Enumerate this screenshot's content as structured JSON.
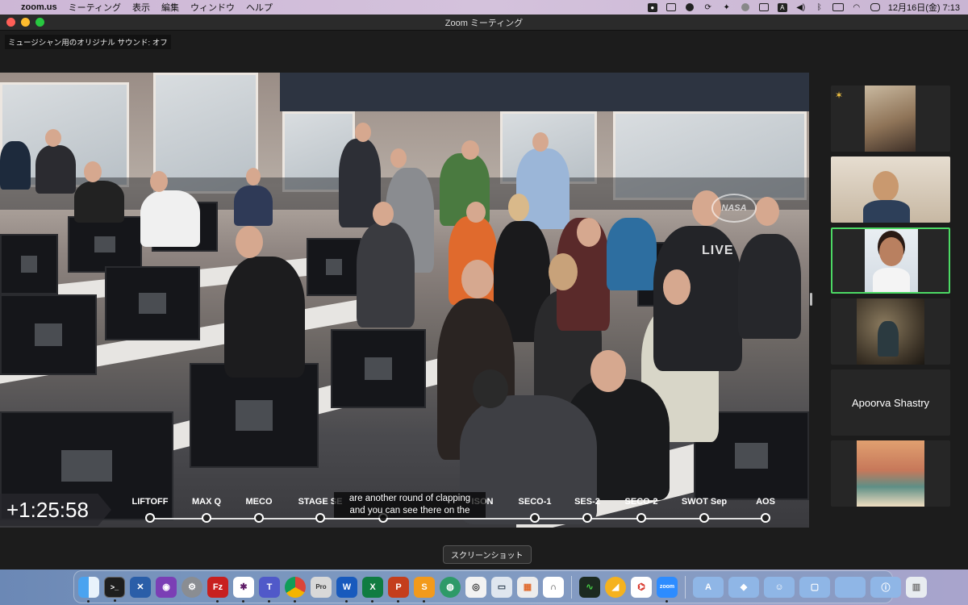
{
  "menubar": {
    "app_name": "zoom.us",
    "menus": [
      "ミーティング",
      "表示",
      "編集",
      "ウィンドウ",
      "ヘルプ"
    ],
    "datetime": "12月16日(金)  7:13",
    "status_icons": [
      "notification-badge-icon",
      "screen-mirror-icon",
      "pinwheel-icon",
      "refresh-icon",
      "figure-icon",
      "circle-icon",
      "grid-icon",
      "text-icon",
      "volume-icon",
      "bluetooth-icon",
      "battery-icon",
      "wifi-icon",
      "control-center-icon",
      "siri-icon"
    ]
  },
  "window": {
    "title": "Zoom ミーティング"
  },
  "meeting": {
    "sound_label": "ミュージシャン用のオリジナル サウンド: オフ",
    "shared_video": {
      "elapsed": "+1:25:58",
      "caption_line1": "are another round of clapping",
      "caption_line2": "and you can see there on the",
      "watermark": "LIVE",
      "logo_text": "NASA",
      "timeline": [
        "LIFTOFF",
        "MAX Q",
        "MECO",
        "STAGE SE",
        "",
        "ISON",
        "SECO-1",
        "SES-2",
        "SECO-2",
        "SWOT Sep",
        "AOS"
      ]
    },
    "participants": [
      {
        "type": "video",
        "desc": "group-room"
      },
      {
        "type": "video",
        "desc": "man-glasses"
      },
      {
        "type": "video",
        "desc": "woman-smiling",
        "active": true
      },
      {
        "type": "video",
        "desc": "woman-cave"
      },
      {
        "type": "name",
        "name": "Apoorva Shastry"
      },
      {
        "type": "video",
        "desc": "illustration"
      }
    ]
  },
  "tooltip": "スクリーンショット",
  "dock": {
    "apps": [
      "Finder",
      "Terminal",
      "Xcode",
      "GitHub",
      "System Preferences",
      "FileZilla",
      "Slack",
      "Teams",
      "Chrome",
      "Pro",
      "Word",
      "Excel",
      "PowerPoint",
      "Sublime",
      "Network",
      "Screenshot",
      "Preview",
      "Launchpad",
      "Keynote",
      "Activity Monitor",
      "Linear",
      "Acrobat",
      "Zoom"
    ],
    "folders": [
      "Applications",
      "Dropbox",
      "Users",
      "Documents",
      "Downloads",
      "Info",
      "Trash"
    ]
  },
  "colors": {
    "active_speaker_border": "#4cd964",
    "menubar_bg": "#cdb7d6"
  }
}
